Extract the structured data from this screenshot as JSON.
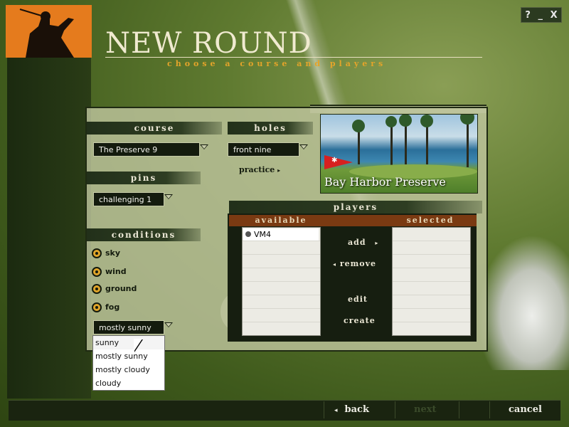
{
  "window_controls": {
    "help": "?",
    "minimize": "_",
    "close": "X"
  },
  "header": {
    "title": "NEW ROUND",
    "subtitle": "choose a course and players"
  },
  "course": {
    "label": "course",
    "value": "The Preserve 9"
  },
  "holes": {
    "label": "holes",
    "value": "front nine",
    "practice_label": "practice"
  },
  "pins": {
    "label": "pins",
    "value": "challenging 1"
  },
  "conditions": {
    "label": "conditions",
    "options": [
      "sky",
      "wind",
      "ground",
      "fog"
    ],
    "selected_value": "mostly sunny",
    "dropdown_options": [
      "sunny",
      "mostly sunny",
      "mostly cloudy",
      "cloudy"
    ]
  },
  "course_preview": {
    "caption": "Bay Harbor Preserve"
  },
  "players": {
    "label": "players",
    "available_label": "available",
    "selected_label": "selected",
    "available": [
      "VM4"
    ],
    "selected": [],
    "add_label": "add",
    "remove_label": "remove",
    "edit_label": "edit",
    "create_label": "create"
  },
  "footer": {
    "back_label": "back",
    "next_label": "next",
    "cancel_label": "cancel"
  },
  "colors": {
    "accent": "#e57b1d",
    "subtitle": "#e4a42a",
    "list_header": "#7a3a12"
  }
}
